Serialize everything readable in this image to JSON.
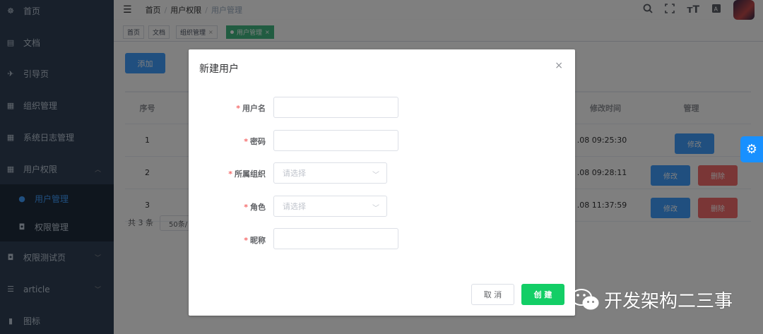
{
  "sidebar": {
    "items": [
      {
        "icon": "dashboard-icon",
        "glyph": "☸",
        "label": "首页"
      },
      {
        "icon": "document-icon",
        "glyph": "▤",
        "label": "文档"
      },
      {
        "icon": "guide-icon",
        "glyph": "✈",
        "label": "引导页"
      },
      {
        "icon": "table-icon",
        "glyph": "▦",
        "label": "组织管理"
      },
      {
        "icon": "table-icon",
        "glyph": "▦",
        "label": "系统日志管理"
      },
      {
        "icon": "table-icon",
        "glyph": "▦",
        "label": "用户权限"
      },
      {
        "icon": "user-icon",
        "glyph": "●",
        "label": "用户管理"
      },
      {
        "icon": "lock-icon",
        "glyph": "🔒︎",
        "label": "权限管理"
      },
      {
        "icon": "lock-icon",
        "glyph": "🔒︎",
        "label": "权限测试页"
      },
      {
        "icon": "list-icon",
        "glyph": "☰",
        "label": "article"
      },
      {
        "icon": "chart-icon",
        "glyph": "▮",
        "label": "图标"
      }
    ]
  },
  "navbar": {
    "breadcrumb": [
      "首页",
      "用户权限",
      "用户管理"
    ],
    "separator": "/"
  },
  "tags": [
    {
      "label": "首页",
      "closable": false,
      "active": false
    },
    {
      "label": "文档",
      "closable": false,
      "active": false
    },
    {
      "label": "组织管理",
      "closable": true,
      "active": false
    },
    {
      "label": "用户管理",
      "closable": true,
      "active": true
    }
  ],
  "tag_close_glyph": "×",
  "main": {
    "add_button": "添加",
    "table": {
      "headers": {
        "index": "序号",
        "modified": "修改时间",
        "manage": "管理"
      },
      "rows": [
        {
          "index": "1",
          "modified": ".08 09:25:30",
          "edit": "修改",
          "delete": null
        },
        {
          "index": "2",
          "modified": ".08 09:28:11",
          "edit": "修改",
          "delete": "删除"
        },
        {
          "index": "3",
          "modified": ".08 11:37:59",
          "edit": "修改",
          "delete": "删除"
        }
      ]
    },
    "total_text": "共 3 条",
    "page_size": "50条/"
  },
  "dialog": {
    "title": "新建用户",
    "close_glyph": "×",
    "required_mark": "*",
    "fields": [
      {
        "label": "用户名",
        "type": "input",
        "value": ""
      },
      {
        "label": "密码",
        "type": "input",
        "value": ""
      },
      {
        "label": "所属组织",
        "type": "select",
        "placeholder": "请选择"
      },
      {
        "label": "角色",
        "type": "select",
        "placeholder": "请选择"
      },
      {
        "label": "昵称",
        "type": "input",
        "value": ""
      }
    ],
    "cancel": "取 消",
    "create": "创 建"
  },
  "watermark": "开发架构二三事",
  "colors": {
    "sidebar": "#304156",
    "primary": "#409eff",
    "success": "#13ce66",
    "danger": "#f56c6c",
    "tag_active": "#42b983"
  }
}
